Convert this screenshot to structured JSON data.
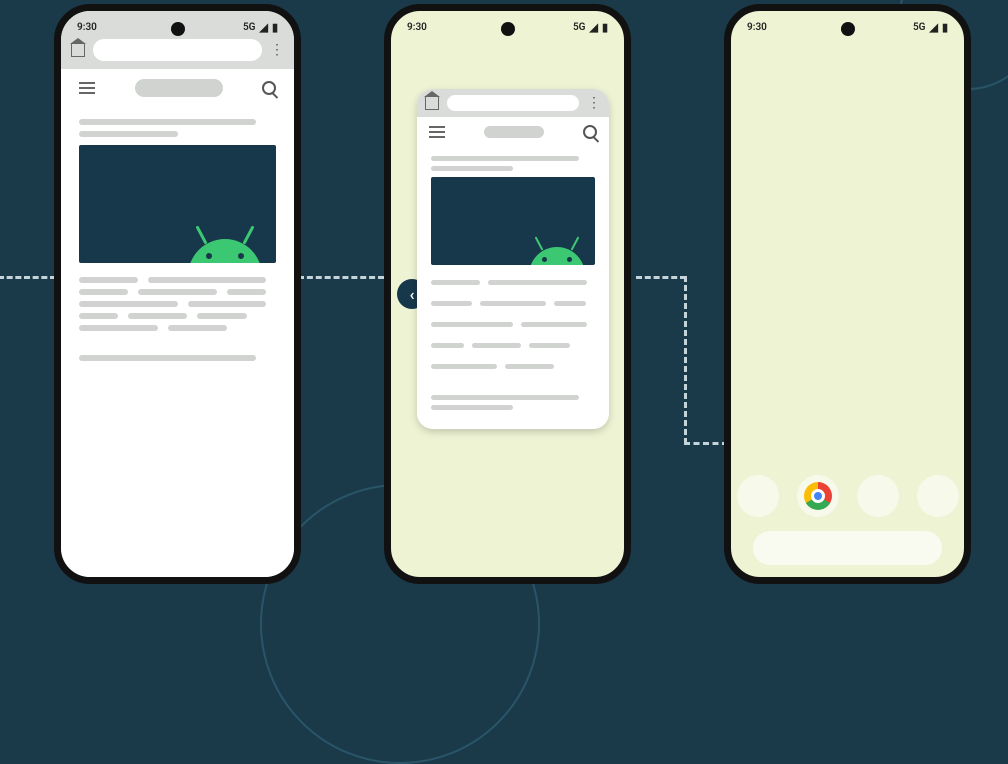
{
  "statusbar": {
    "time": "9:30",
    "network": "5G"
  },
  "phone3": {
    "dock_app": "Chrome"
  }
}
